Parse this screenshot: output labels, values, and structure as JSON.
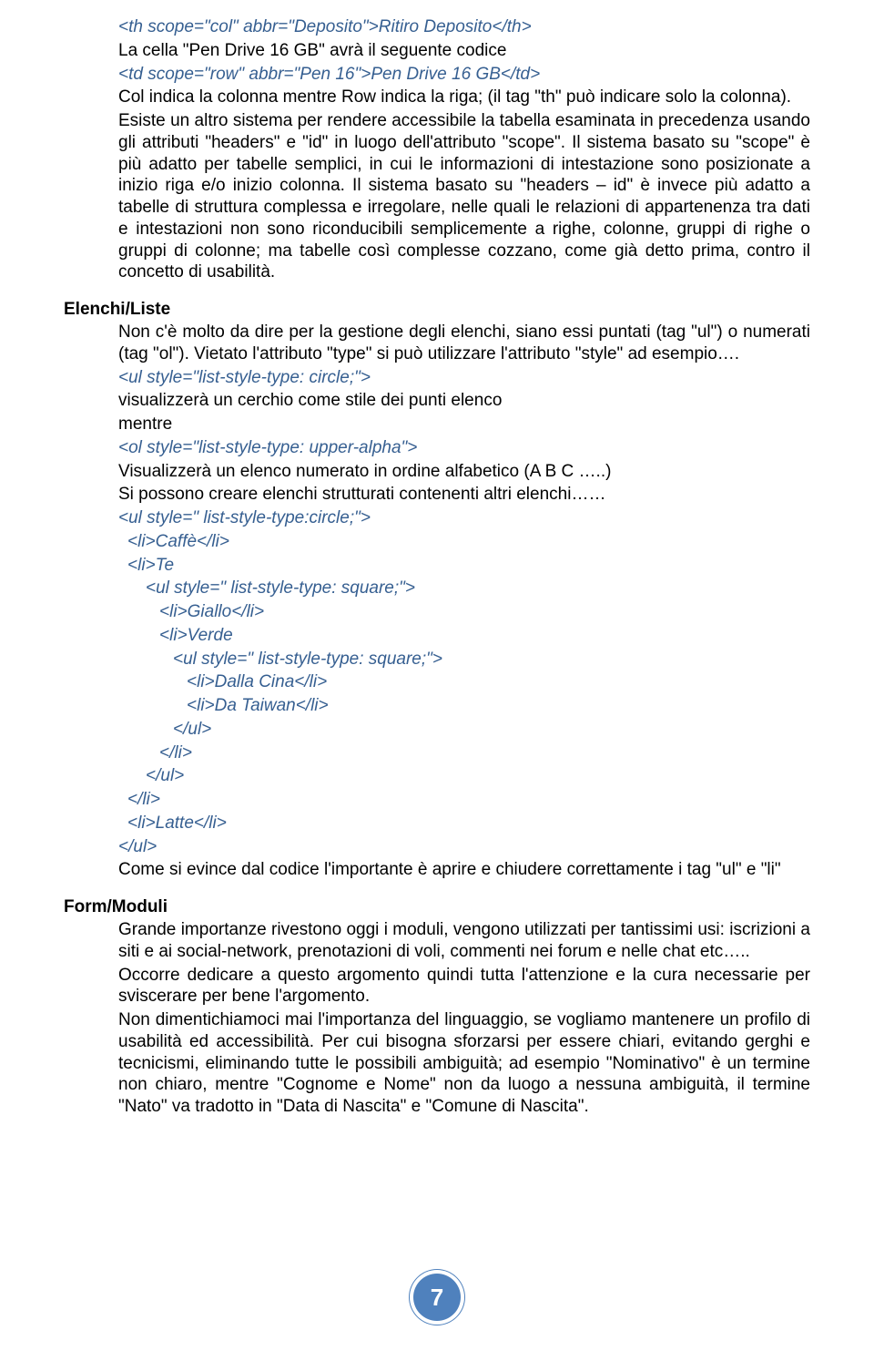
{
  "topBlock": {
    "line1": "<th scope=\"col\" abbr=\"Deposito\">Ritiro Deposito</th>",
    "line2": "La cella \"Pen Drive 16 GB\" avrà il seguente codice",
    "line3": "<td scope=\"row\" abbr=\"Pen 16\">Pen Drive 16 GB</td>",
    "line4": "Col indica la colonna mentre Row indica la riga; (il tag \"th\" può indicare solo la colonna).",
    "line5": "Esiste un altro sistema per rendere accessibile la tabella esaminata in precedenza usando gli attributi \"headers\" e \"id\" in luogo dell'attributo \"scope\". Il sistema basato su \"scope\" è più adatto per tabelle semplici, in cui le informazioni di intestazione sono posizionate a inizio riga e/o inizio colonna. Il sistema basato su \"headers – id\" è invece più adatto a tabelle di struttura complessa e irregolare, nelle quali le relazioni di appartenenza tra dati e intestazioni non sono riconducibili semplicemente a righe, colonne, gruppi di righe o gruppi di colonne; ma tabelle così complesse cozzano, come già detto prima, contro il concetto di usabilità."
  },
  "elenchi": {
    "heading": "Elenchi/Liste",
    "p1": "Non c'è molto da dire per la gestione degli elenchi, siano essi puntati (tag \"ul\") o numerati (tag \"ol\"). Vietato l'attributo \"type\" si può utilizzare l'attributo \"style\" ad esempio….",
    "code1": "<ul style=\"list-style-type: circle;\">",
    "p2": "visualizzerà un cerchio come stile dei punti elenco",
    "p3": "mentre",
    "code2": "<ol style=\"list-style-type: upper-alpha\">",
    "p4": "Visualizzerà un elenco numerato in ordine alfabetico (A B C …..)",
    "p5": "Si possono creare elenchi strutturati contenenti altri elenchi……",
    "code3": "<ul style=\" list-style-type:circle;\">",
    "code4": "<li>Caffè</li>",
    "code5": "<li>Te",
    "code6": "<ul style=\" list-style-type: square;\">",
    "code7": "<li>Giallo</li>",
    "code8": "<li>Verde",
    "code9": "<ul style=\" list-style-type: square;\">",
    "code10": "<li>Dalla Cina</li>",
    "code11": "<li>Da Taiwan</li>",
    "code12": "</ul>",
    "code13": "</li>",
    "code14": "</ul>",
    "code15": "</li>",
    "code16": "<li>Latte</li>",
    "code17": "</ul>",
    "p6": "Come si evince dal codice l'importante è aprire e chiudere correttamente i tag \"ul\" e \"li\""
  },
  "form": {
    "heading": "Form/Moduli",
    "p1": "Grande importanze rivestono oggi i moduli, vengono utilizzati per tantissimi usi: iscrizioni a siti e ai social-network, prenotazioni di voli, commenti nei forum e nelle chat etc…..",
    "p2": "Occorre dedicare a questo argomento quindi tutta l'attenzione e la cura necessarie per sviscerare per bene l'argomento.",
    "p3": "Non dimentichiamoci mai l'importanza del linguaggio, se vogliamo mantenere un profilo di usabilità ed accessibilità. Per cui bisogna sforzarsi per essere chiari, evitando gerghi e tecnicismi, eliminando tutte le possibili ambiguità; ad esempio \"Nominativo\" è un termine non chiaro, mentre \"Cognome e Nome\" non da  luogo a nessuna ambiguità, il termine \"Nato\" va tradotto in \"Data di Nascita\" e \"Comune di Nascita\"."
  },
  "pageNumber": "7"
}
